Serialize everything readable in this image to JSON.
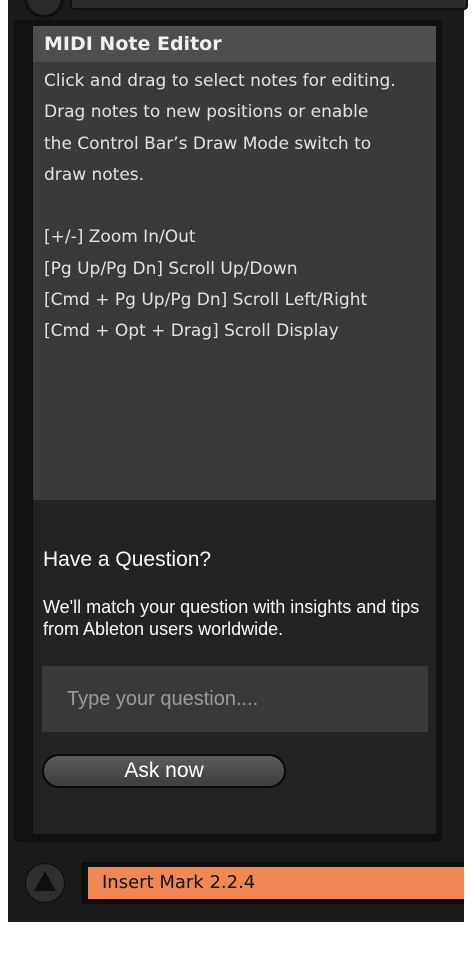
{
  "help": {
    "title": "MIDI Note Editor",
    "lines": [
      "Click and drag to select notes for editing.",
      "Drag notes to new positions or enable",
      "the Control Bar’s Draw Mode switch to",
      "draw notes."
    ],
    "shortcuts": [
      "[+/-] Zoom In/Out",
      "[Pg Up/Pg Dn] Scroll Up/Down",
      "[Cmd + Pg Up/Pg Dn] Scroll Left/Right",
      "[Cmd + Opt + Drag] Scroll Display"
    ]
  },
  "question": {
    "title": "Have a Question?",
    "description": "We'll match your question with insights and tips from Ableton users worldwide.",
    "input_placeholder": "Type your question....",
    "ask_label": "Ask now"
  },
  "status": {
    "text": "Insert Mark 2.2.4",
    "accent_color": "#ef8854"
  },
  "icons": {
    "bottom_left": "triangle-icon"
  }
}
